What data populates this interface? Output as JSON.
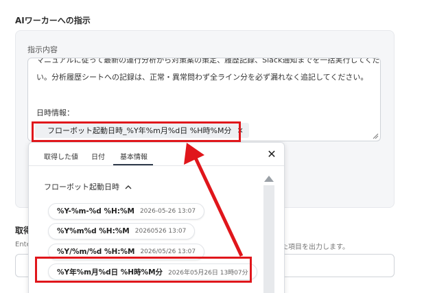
{
  "section": {
    "title": "AIワーカーへの指示"
  },
  "instruction": {
    "label": "指示内容",
    "line1": "マニュアルに従って最新の運行分析から対策案の策定、履歴記録、Slack通知までを一括実行してください",
    "line2": "い。分析履歴シートへの記録は、正常・異常問わず全ライン分を必ず漏れなく追記してください。",
    "line3": "日時情報：",
    "chip_label": "フローボット起動日時_%Y年%m月%d日 %H時%M分",
    "chip_close": "✕"
  },
  "output_section": {
    "label": "取得",
    "desc_prefix": "Ente",
    "desc_suffix": "した項目を出力します。"
  },
  "popup": {
    "tabs": [
      "取得した値",
      "日付",
      "基本情報"
    ],
    "active_tab": "基本情報",
    "close": "✕",
    "group_label": "フローボット起動日時",
    "group_chevron": "^",
    "options": [
      {
        "format": "%Y-%m-%d %H:%M",
        "sample": "2026-05-26 13:07"
      },
      {
        "format": "%Y%m%d %H:%M",
        "sample": "20260526 13:07"
      },
      {
        "format": "%Y/%m/%d %H:%M",
        "sample": "2026/05/26 13:07"
      },
      {
        "format": "%Y年%m月%d日 %H時%M分",
        "sample": "2026年05月26日 13時07分"
      }
    ]
  },
  "colors": {
    "highlight": "#e0161b",
    "card_bg": "#f5f6f8",
    "tab_underline": "#2f3a4a"
  }
}
